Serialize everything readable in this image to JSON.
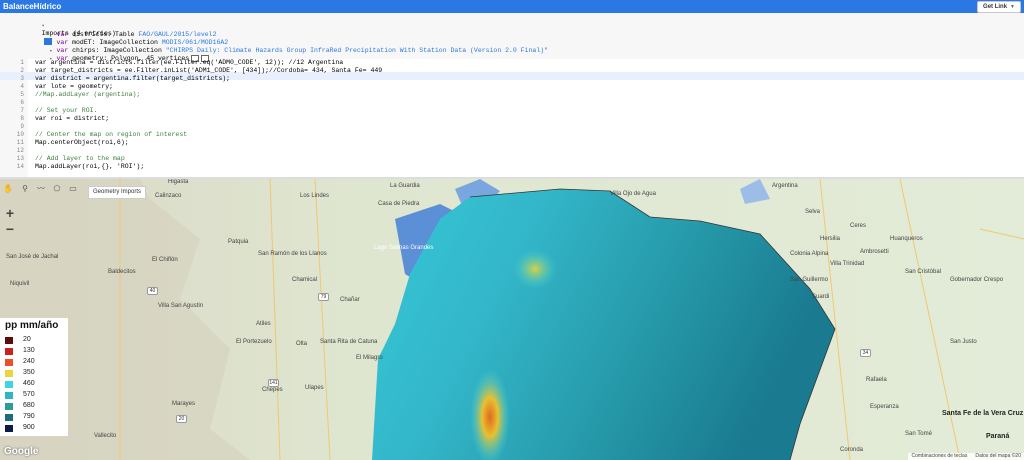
{
  "app": {
    "title": "BalanceHídrico",
    "get_link": "Get Link"
  },
  "imports": {
    "header": "Imports (4 entries)",
    "rows": [
      {
        "kw": "var",
        "name": " districts",
        "sep": ": Table ",
        "value": "FAO/GAUL/2015/level2"
      },
      {
        "kw": "var",
        "name": " modET",
        "sep": ": ImageCollection ",
        "value": "MODIS/061/MOD16A2"
      },
      {
        "kw": "var",
        "name": " chirps",
        "sep": ": ImageCollection ",
        "value": "\"CHIRPS Daily: Climate Hazards Group InfraRed Precipitation With Station Data (Version 2.0 Final)\""
      },
      {
        "kw": "var",
        "name": " geometry",
        "sep": ": Polygon, 45 vertices",
        "value": ""
      }
    ]
  },
  "code_lines": [
    {
      "n": "1",
      "text": "var argentina = districts.filter(ee.Filter.eq('ADM0_CODE', 12)); //12 Argentina"
    },
    {
      "n": "2",
      "text": "var target_districts = ee.Filter.inList('ADM1_CODE', [434]);//Cordoba= 434, Santa Fe= 449"
    },
    {
      "n": "3",
      "text": "var district = argentina.filter(target_districts);"
    },
    {
      "n": "4",
      "text": "var lote = geometry;"
    },
    {
      "n": "5",
      "text": "//Map.addLayer (argentina);"
    },
    {
      "n": "6",
      "text": ""
    },
    {
      "n": "7",
      "text": "// Set your ROI."
    },
    {
      "n": "8",
      "text": "var roi = district;"
    },
    {
      "n": "9",
      "text": ""
    },
    {
      "n": "10",
      "text": "// Center the map on region of interest"
    },
    {
      "n": "11",
      "text": "Map.centerObject(roi,6);"
    },
    {
      "n": "12",
      "text": ""
    },
    {
      "n": "13",
      "text": "// Add layer to the map"
    },
    {
      "n": "14",
      "text": "Map.addLayer(roi,{}, 'ROI');"
    }
  ],
  "map": {
    "tooltip": "Geometry Imports",
    "zoom_in": "+",
    "zoom_out": "−",
    "google": "Google",
    "attribution": [
      "Combinaciones de teclas",
      "Datos del mapa ©20"
    ],
    "tools": [
      "hand-icon",
      "point-icon",
      "line-icon",
      "polygon-icon",
      "rectangle-icon"
    ]
  },
  "legend": {
    "title": "pp mm/año",
    "items": [
      {
        "label": "20",
        "color": "#5c0a0a"
      },
      {
        "label": "130",
        "color": "#c9211c"
      },
      {
        "label": "240",
        "color": "#ee4e2b"
      },
      {
        "label": "350",
        "color": "#e8d63a"
      },
      {
        "label": "460",
        "color": "#3dd6e0"
      },
      {
        "label": "570",
        "color": "#2fb4c4"
      },
      {
        "label": "680",
        "color": "#2a9d9a"
      },
      {
        "label": "790",
        "color": "#1c6c7c"
      },
      {
        "label": "900",
        "color": "#0d1a45"
      }
    ]
  },
  "places": [
    {
      "t": "Higasta"
    },
    {
      "t": "Calinzaco"
    },
    {
      "t": "Los Lindes"
    },
    {
      "t": "San José de Jachal"
    },
    {
      "t": "El Chiflón"
    },
    {
      "t": "Baldecitos"
    },
    {
      "t": "Patquia"
    },
    {
      "t": "San Ramón de los Llanos"
    },
    {
      "t": "Niquivil"
    },
    {
      "t": "Chamical"
    },
    {
      "t": "Villa San Agustín"
    },
    {
      "t": "Chañar"
    },
    {
      "t": "Atiles"
    },
    {
      "t": "El Portezuelo"
    },
    {
      "t": "Olta"
    },
    {
      "t": "Santa Rita de Catuna"
    },
    {
      "t": "El Milagro"
    },
    {
      "t": "Chepes"
    },
    {
      "t": "Ulapes"
    },
    {
      "t": "Marayes"
    },
    {
      "t": "Vallecito"
    },
    {
      "t": "La Guardia"
    },
    {
      "t": "Casa de Piedra"
    },
    {
      "t": "Lago Salinas Grandes"
    },
    {
      "t": "Villa Ojo de Agua"
    },
    {
      "t": "Argentina"
    },
    {
      "t": "Selva"
    },
    {
      "t": "Ceres"
    },
    {
      "t": "Hersilia"
    },
    {
      "t": "Huanqueros"
    },
    {
      "t": "Colonia Alpina"
    },
    {
      "t": "Ambrosetti"
    },
    {
      "t": "Villa Trinidad"
    },
    {
      "t": "San Cristóbal"
    },
    {
      "t": "San Guillermo"
    },
    {
      "t": "Suardi"
    },
    {
      "t": "Gobernador Crespo"
    },
    {
      "t": "Rafaela"
    },
    {
      "t": "Santa Fe de la Vera Cruz"
    },
    {
      "t": "Paraná"
    },
    {
      "t": "San Tomé"
    },
    {
      "t": "San Justo"
    },
    {
      "t": "Esperanza"
    },
    {
      "t": "Coronda"
    }
  ]
}
